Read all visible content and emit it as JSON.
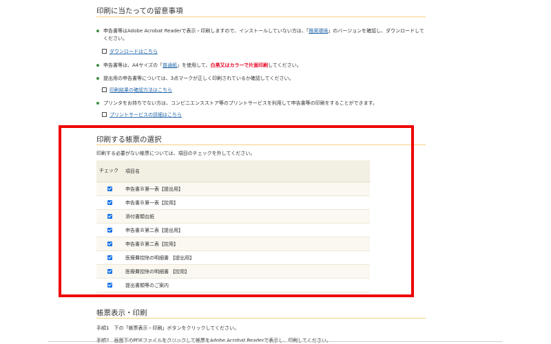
{
  "section1": {
    "title": "印刷に当たっての留意事項",
    "bullets": [
      {
        "pre": "申告書等はAdobe Acrobat Readerで表示・印刷しますので、インストールしていない方は、「",
        "link": "推奨環境",
        "post": "」のバージョンを確認し、ダウンロードしてください。"
      },
      {
        "pre": "申告書等は、A4サイズの「",
        "link": "普通紙",
        "mid": "」を使用して、",
        "emph": "白黒又はカラーで片面印刷",
        "post": "してください。"
      },
      {
        "pre": "提出用の申告書等については、3点マークが正しく印刷されているか確認してください。"
      },
      {
        "pre": "プリンタをお持ちでない方は、コンビニエンスストア等のプリントサービスを利用して申告書等の印刷をすることができます。"
      }
    ],
    "links": [
      "ダウンロードはこちら",
      "印刷結果の確認方法はこちら",
      "プリントサービスの詳細はこちら"
    ]
  },
  "section2": {
    "title": "印刷する帳票の選択",
    "note": "印刷する必要がない帳票については、項目のチェックを外してください。",
    "headers": {
      "check": "チェック",
      "name": "項目名"
    },
    "rows": [
      {
        "name": "申告書Ｂ第一表【提出用】",
        "checked": true
      },
      {
        "name": "申告書Ｂ第一表【控用】",
        "checked": true
      },
      {
        "name": "添付書類台紙",
        "checked": true
      },
      {
        "name": "申告書Ｂ第二表【提出用】",
        "checked": true
      },
      {
        "name": "申告書Ｂ第二表【控用】",
        "checked": true
      },
      {
        "name": "医療費控除の明細書 【提出用】",
        "checked": true
      },
      {
        "name": "医療費控除の明細書 【控用】",
        "checked": true
      },
      {
        "name": "提出書類等のご案内",
        "checked": true
      }
    ]
  },
  "section3": {
    "title": "帳票表示・印刷",
    "steps": [
      "手順1　下の「帳票表示・印刷」ボタンをクリックしてください。",
      "手順2　画面下のPDFファイルをクリックして帳票をAdobe Acrobat Readerで表示し、印刷してください。"
    ]
  },
  "colors": {
    "accent_rule": "#f3cf82",
    "highlight_box": "#ee0000",
    "link": "#2266aa",
    "warning": "#e8001f",
    "checkbox": "#1a73e8"
  }
}
